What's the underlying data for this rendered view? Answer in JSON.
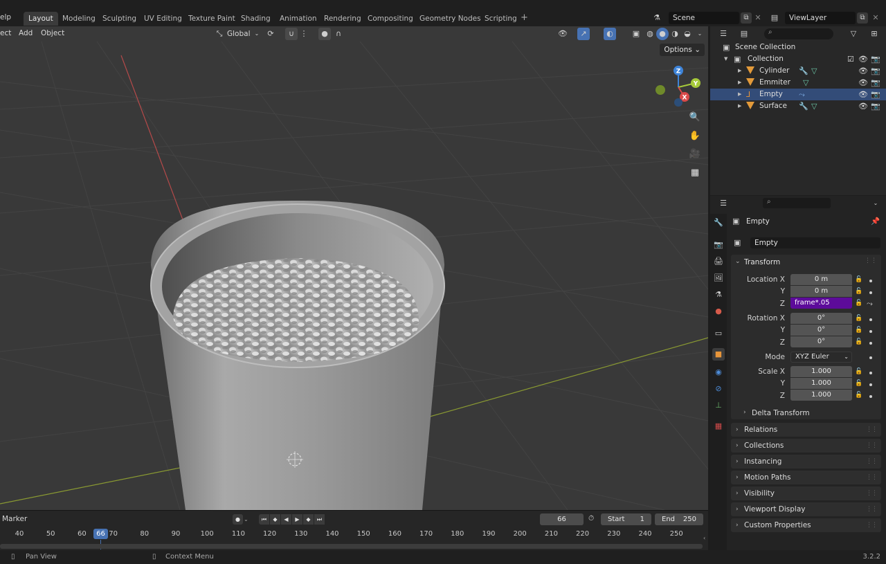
{
  "topbar": {
    "menu_partial": "elp",
    "workspaces": [
      "Layout",
      "Modeling",
      "Sculpting",
      "UV Editing",
      "Texture Paint",
      "Shading",
      "Animation",
      "Rendering",
      "Compositing",
      "Geometry Nodes",
      "Scripting"
    ],
    "active_workspace": "Layout",
    "add_workspace": "+",
    "scene": "Scene",
    "view_layer": "ViewLayer"
  },
  "viewport": {
    "menu": [
      "ect",
      "Add",
      "Object"
    ],
    "orientation": "Global",
    "options_label": "Options",
    "gizmo_axes": {
      "x": "X",
      "y": "Y",
      "z": "Z"
    }
  },
  "outliner": {
    "root": "Scene Collection",
    "collection": "Collection",
    "objects": [
      {
        "name": "Cylinder",
        "selected": false
      },
      {
        "name": "Emmiter",
        "selected": false
      },
      {
        "name": "Empty",
        "selected": true
      },
      {
        "name": "Surface",
        "selected": false
      }
    ]
  },
  "properties": {
    "object_title": "Empty",
    "datablock_name": "Empty",
    "transform": {
      "title": "Transform",
      "location_label": "Location X",
      "location": {
        "x": "0 m",
        "y": "0 m",
        "z_expression": "frame*.05"
      },
      "rotation_label": "Rotation X",
      "rotation": {
        "x": "0°",
        "y": "0°",
        "z": "0°"
      },
      "mode_label": "Mode",
      "mode_value": "XYZ Euler",
      "scale_label": "Scale X",
      "scale": {
        "x": "1.000",
        "y": "1.000",
        "z": "1.000"
      },
      "axis_y": "Y",
      "axis_z": "Z",
      "delta": "Delta Transform"
    },
    "sections": [
      "Relations",
      "Collections",
      "Instancing",
      "Motion Paths",
      "Visibility",
      "Viewport Display",
      "Custom Properties"
    ]
  },
  "timeline": {
    "marker_label": "Marker",
    "current_frame": "66",
    "start_label": "Start",
    "start_value": "1",
    "end_label": "End",
    "end_value": "250",
    "ticks": [
      "40",
      "50",
      "60",
      "70",
      "80",
      "90",
      "100",
      "110",
      "120",
      "130",
      "140",
      "150",
      "160",
      "170",
      "180",
      "190",
      "200",
      "210",
      "220",
      "230",
      "240",
      "250"
    ]
  },
  "statusbar": {
    "pan_view": "Pan View",
    "context_menu": "Context Menu",
    "version": "3.2.2"
  },
  "colors": {
    "selection": "#334c78",
    "editing_field": "#5d0b9a",
    "current_frame": "#4772b3",
    "x_axis": "#d94a4a",
    "y_axis": "#a6c93a",
    "z_axis": "#3e84d9"
  }
}
